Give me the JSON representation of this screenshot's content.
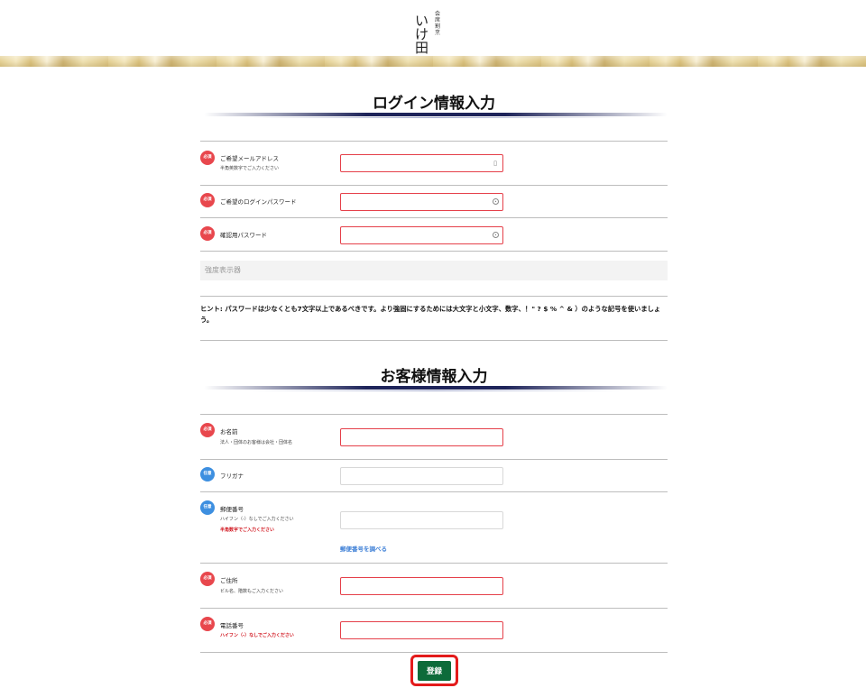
{
  "header": {
    "logo_main": "いけ田",
    "logo_sub": "会席割烹"
  },
  "login_section": {
    "title": "ログイン情報入力",
    "fields": [
      {
        "badge": "必須",
        "label": "ご希望メールアドレス",
        "sub": "半角英数字でご入力ください",
        "value": "",
        "icon": "contact-card-icon"
      },
      {
        "badge": "必須",
        "label": "ご希望のログインパスワード",
        "sub": "",
        "value": "",
        "icon": "eye-icon"
      },
      {
        "badge": "必須",
        "label": "確認用パスワード",
        "sub": "",
        "value": "",
        "icon": "eye-icon"
      }
    ],
    "strength_label": "強度表示器",
    "hint": "ヒント: パスワードは少なくとも7文字以上であるべきです。より強固にするためには大文字と小文字、数字、！\" ? $ % ^ & ）のような記号を使いましょう。"
  },
  "customer_section": {
    "title": "お客様情報入力",
    "fields": [
      {
        "badge": "必須",
        "label": "お名前",
        "sub": "法人・団体のお客様は会社・団体名",
        "sub2": ""
      },
      {
        "badge": "任意",
        "label": "フリガナ",
        "sub": "",
        "sub2": ""
      },
      {
        "badge": "任意",
        "label": "郵便番号",
        "sub": "ハイフン（-）なしでご入力ください",
        "sub2": "半角数字でご入力ください"
      },
      {
        "badge": "必須",
        "label": "ご住所",
        "sub": "ビル名、階数もご入力ください",
        "sub2": ""
      },
      {
        "badge": "必須",
        "label": "電話番号",
        "sub": "",
        "sub2": "ハイフン（-）なしでご入力ください"
      }
    ],
    "zip_lookup_link": "郵便番号を調べる"
  },
  "submit_label": "登録",
  "colors": {
    "required_badge": "#e8474d",
    "optional_badge": "#3d8fe0",
    "error_border": "#e5404a",
    "submit_bg": "#0d6b3a",
    "highlight": "#e31b1b"
  }
}
